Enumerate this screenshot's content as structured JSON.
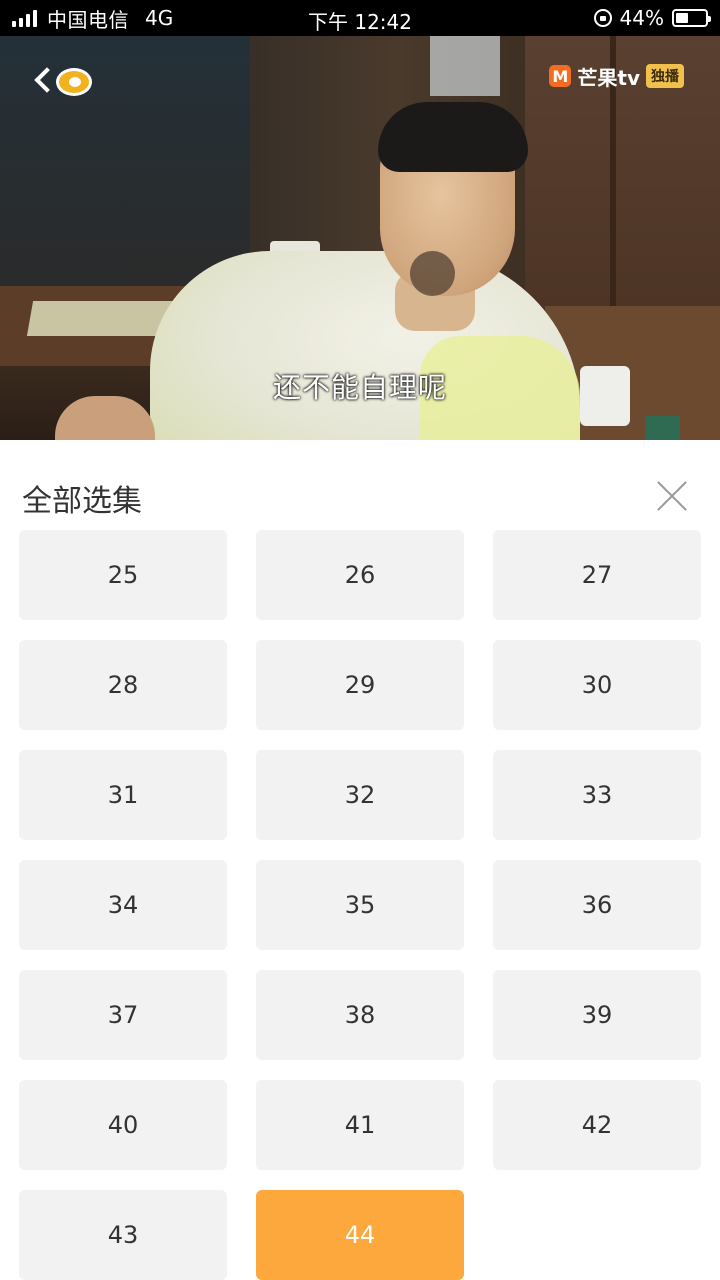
{
  "status_bar": {
    "carrier": "中国电信",
    "network": "4G",
    "time": "下午 12:42",
    "battery": "44%",
    "battery_level": 0.44
  },
  "video": {
    "brand": "芒果tv",
    "brand_badge": "独播",
    "subtitle": "还不能自理呢"
  },
  "panel": {
    "title": "全部选集",
    "episodes": [
      "25",
      "26",
      "27",
      "28",
      "29",
      "30",
      "31",
      "32",
      "33",
      "34",
      "35",
      "36",
      "37",
      "38",
      "39",
      "40",
      "41",
      "42",
      "43",
      "44"
    ],
    "active_episode": "44",
    "accent_color": "#fca83c"
  }
}
